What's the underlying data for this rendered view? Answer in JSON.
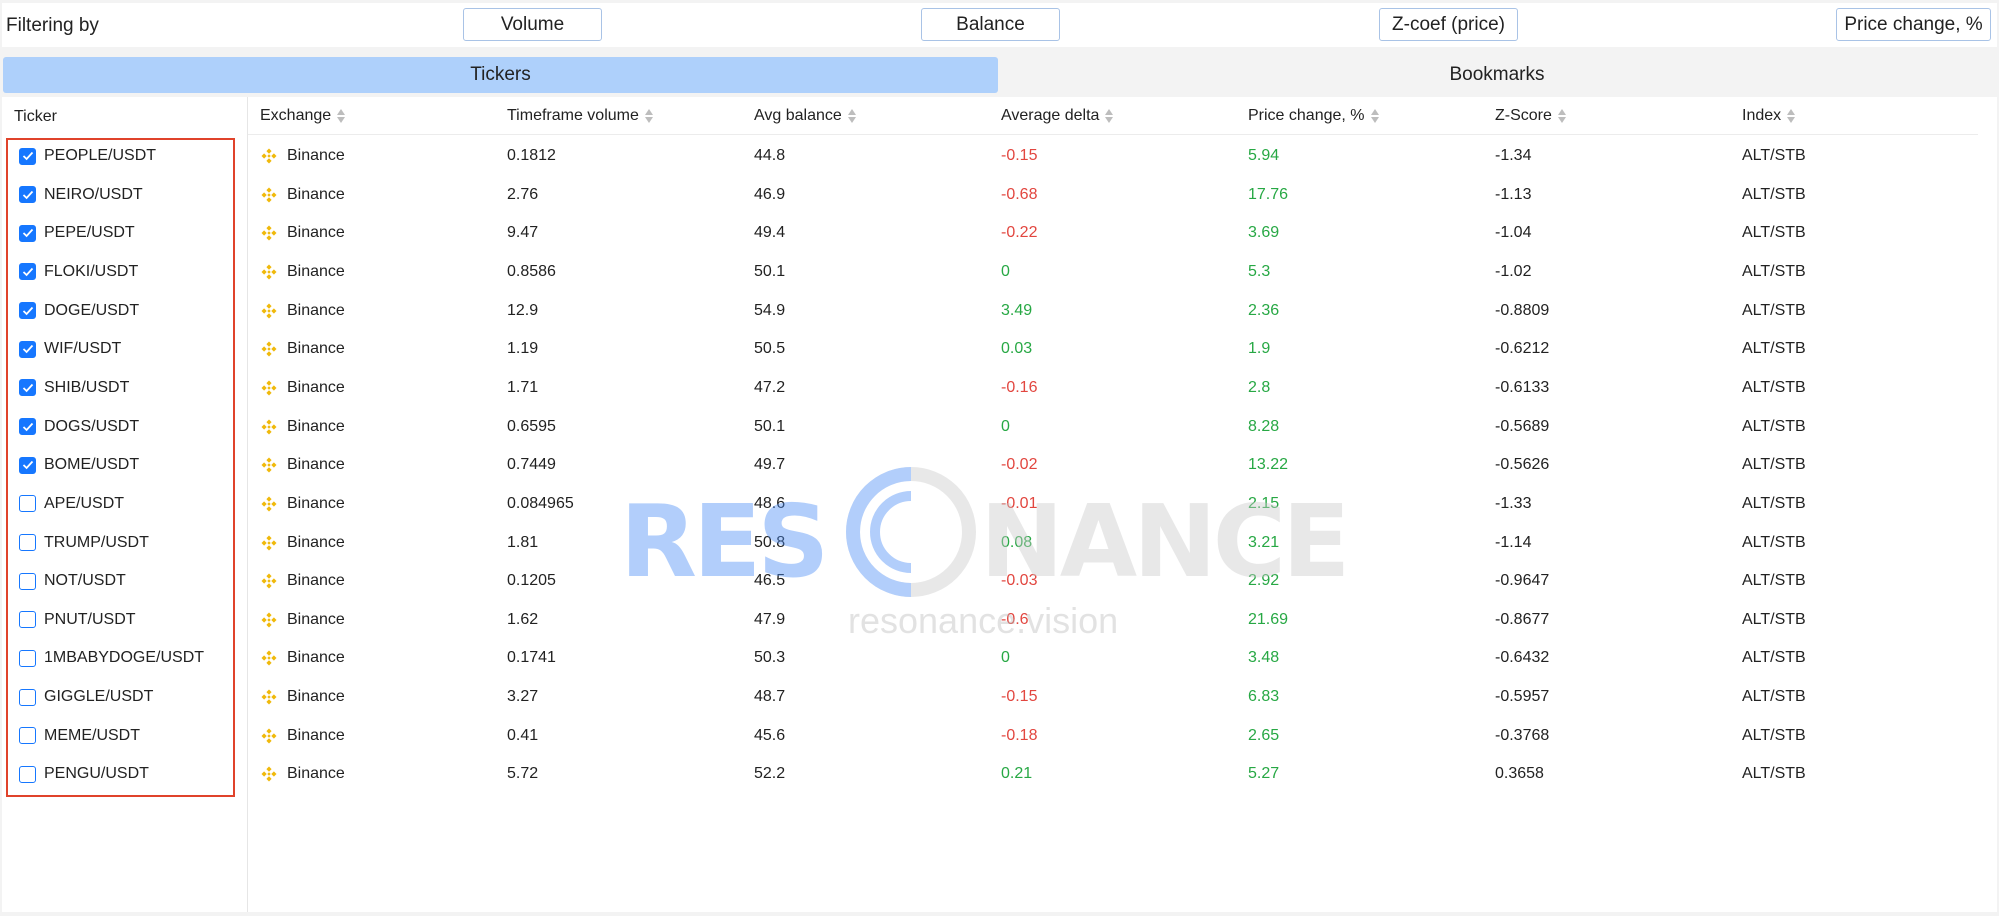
{
  "filters": {
    "label": "Filtering by",
    "buttons": [
      "Volume",
      "Balance",
      "Z-coef (price)",
      "Price change, %"
    ]
  },
  "tabs": {
    "tickers": "Tickers",
    "bookmarks": "Bookmarks"
  },
  "ticker_list": {
    "header": "Ticker",
    "items": [
      {
        "name": "PEOPLE/USDT",
        "checked": true
      },
      {
        "name": "NEIRO/USDT",
        "checked": true
      },
      {
        "name": "PEPE/USDT",
        "checked": true
      },
      {
        "name": "FLOKI/USDT",
        "checked": true
      },
      {
        "name": "DOGE/USDT",
        "checked": true
      },
      {
        "name": "WIF/USDT",
        "checked": true
      },
      {
        "name": "SHIB/USDT",
        "checked": true
      },
      {
        "name": "DOGS/USDT",
        "checked": true
      },
      {
        "name": "BOME/USDT",
        "checked": true
      },
      {
        "name": "APE/USDT",
        "checked": false
      },
      {
        "name": "TRUMP/USDT",
        "checked": false
      },
      {
        "name": "NOT/USDT",
        "checked": false
      },
      {
        "name": "PNUT/USDT",
        "checked": false
      },
      {
        "name": "1MBABYDOGE/USDT",
        "checked": false
      },
      {
        "name": "GIGGLE/USDT",
        "checked": false
      },
      {
        "name": "MEME/USDT",
        "checked": false
      },
      {
        "name": "PENGU/USDT",
        "checked": false
      }
    ]
  },
  "table": {
    "columns": [
      "Exchange",
      "Timeframe volume",
      "Avg balance",
      "Average delta",
      "Price change, %",
      "Z-Score",
      "Index"
    ],
    "rows": [
      {
        "exchange": "Binance",
        "volume": "0.1812",
        "avg_balance": "44.8",
        "avg_delta": "-0.15",
        "delta_sign": "neg",
        "price_change": "5.94",
        "zscore": "-1.34",
        "index": "ALT/STB"
      },
      {
        "exchange": "Binance",
        "volume": "2.76",
        "avg_balance": "46.9",
        "avg_delta": "-0.68",
        "delta_sign": "neg",
        "price_change": "17.76",
        "zscore": "-1.13",
        "index": "ALT/STB"
      },
      {
        "exchange": "Binance",
        "volume": "9.47",
        "avg_balance": "49.4",
        "avg_delta": "-0.22",
        "delta_sign": "neg",
        "price_change": "3.69",
        "zscore": "-1.04",
        "index": "ALT/STB"
      },
      {
        "exchange": "Binance",
        "volume": "0.8586",
        "avg_balance": "50.1",
        "avg_delta": "0",
        "delta_sign": "pos",
        "price_change": "5.3",
        "zscore": "-1.02",
        "index": "ALT/STB"
      },
      {
        "exchange": "Binance",
        "volume": "12.9",
        "avg_balance": "54.9",
        "avg_delta": "3.49",
        "delta_sign": "pos",
        "price_change": "2.36",
        "zscore": "-0.8809",
        "index": "ALT/STB"
      },
      {
        "exchange": "Binance",
        "volume": "1.19",
        "avg_balance": "50.5",
        "avg_delta": "0.03",
        "delta_sign": "pos",
        "price_change": "1.9",
        "zscore": "-0.6212",
        "index": "ALT/STB"
      },
      {
        "exchange": "Binance",
        "volume": "1.71",
        "avg_balance": "47.2",
        "avg_delta": "-0.16",
        "delta_sign": "neg",
        "price_change": "2.8",
        "zscore": "-0.6133",
        "index": "ALT/STB"
      },
      {
        "exchange": "Binance",
        "volume": "0.6595",
        "avg_balance": "50.1",
        "avg_delta": "0",
        "delta_sign": "pos",
        "price_change": "8.28",
        "zscore": "-0.5689",
        "index": "ALT/STB"
      },
      {
        "exchange": "Binance",
        "volume": "0.7449",
        "avg_balance": "49.7",
        "avg_delta": "-0.02",
        "delta_sign": "neg",
        "price_change": "13.22",
        "zscore": "-0.5626",
        "index": "ALT/STB"
      },
      {
        "exchange": "Binance",
        "volume": "0.084965",
        "avg_balance": "48.6",
        "avg_delta": "-0.01",
        "delta_sign": "neg",
        "price_change": "2.15",
        "zscore": "-1.33",
        "index": "ALT/STB"
      },
      {
        "exchange": "Binance",
        "volume": "1.81",
        "avg_balance": "50.8",
        "avg_delta": "0.08",
        "delta_sign": "pos",
        "price_change": "3.21",
        "zscore": "-1.14",
        "index": "ALT/STB"
      },
      {
        "exchange": "Binance",
        "volume": "0.1205",
        "avg_balance": "46.5",
        "avg_delta": "-0.03",
        "delta_sign": "neg",
        "price_change": "2.92",
        "zscore": "-0.9647",
        "index": "ALT/STB"
      },
      {
        "exchange": "Binance",
        "volume": "1.62",
        "avg_balance": "47.9",
        "avg_delta": "-0.6",
        "delta_sign": "neg",
        "price_change": "21.69",
        "zscore": "-0.8677",
        "index": "ALT/STB"
      },
      {
        "exchange": "Binance",
        "volume": "0.1741",
        "avg_balance": "50.3",
        "avg_delta": "0",
        "delta_sign": "pos",
        "price_change": "3.48",
        "zscore": "-0.6432",
        "index": "ALT/STB"
      },
      {
        "exchange": "Binance",
        "volume": "3.27",
        "avg_balance": "48.7",
        "avg_delta": "-0.15",
        "delta_sign": "neg",
        "price_change": "6.83",
        "zscore": "-0.5957",
        "index": "ALT/STB"
      },
      {
        "exchange": "Binance",
        "volume": "0.41",
        "avg_balance": "45.6",
        "avg_delta": "-0.18",
        "delta_sign": "neg",
        "price_change": "2.65",
        "zscore": "-0.3768",
        "index": "ALT/STB"
      },
      {
        "exchange": "Binance",
        "volume": "5.72",
        "avg_balance": "52.2",
        "avg_delta": "0.21",
        "delta_sign": "pos",
        "price_change": "5.27",
        "zscore": "0.3658",
        "index": "ALT/STB"
      }
    ]
  },
  "watermark": {
    "brand_left": "RES",
    "brand_right": "NANCE",
    "url": "resonance.vision"
  },
  "colors": {
    "accent": "#1677ff",
    "tab_active": "#aed0fb",
    "negative": "#e2463f",
    "positive": "#27a844",
    "binance": "#f0b90b",
    "highlight_border": "#e0432b"
  }
}
